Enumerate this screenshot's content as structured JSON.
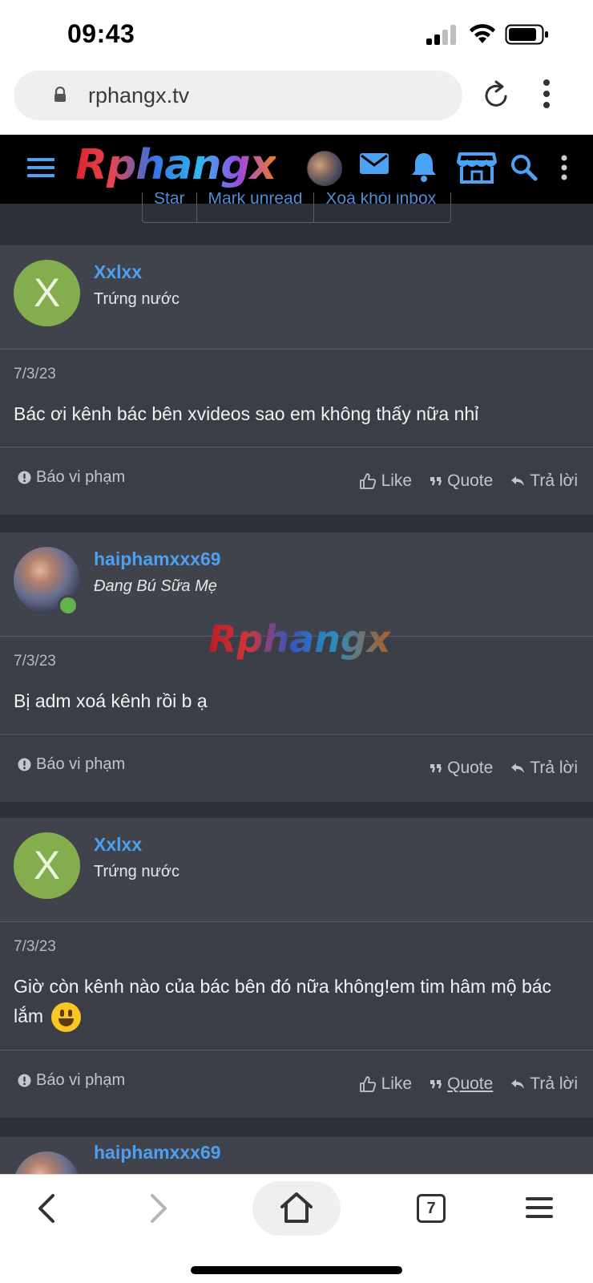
{
  "status_bar": {
    "time": "09:43"
  },
  "browser": {
    "url": "rphangx.tv",
    "tab_count": "7"
  },
  "site": {
    "logo_text": "Rphangx",
    "watermark": "Rphangx"
  },
  "toolbar_remnant": {
    "items": [
      "Star",
      "Mark unread",
      "Xoá khỏi inbox"
    ]
  },
  "colors": {
    "accent": "#4f9ff0",
    "card_bg": "#3b3e46",
    "header_bg": "#000000"
  },
  "messages": [
    {
      "username": "Xxlxx",
      "avatar_letter": "X",
      "user_title": "Trứng nước",
      "date": "7/3/23",
      "text": "Bác ơi kênh bác bên xvideos sao em không thấy nữa nhỉ",
      "report_label": "Báo vi phạm",
      "like_label": "Like",
      "quote_label": "Quote",
      "reply_label": "Trả lời"
    },
    {
      "username": "haiphamxxx69",
      "user_title": "Đang Bú Sữa Mẹ",
      "date": "7/3/23",
      "text": "Bị adm xoá kênh rồi b ạ",
      "report_label": "Báo vi phạm",
      "quote_label": "Quote",
      "reply_label": "Trả lời"
    },
    {
      "username": "Xxlxx",
      "avatar_letter": "X",
      "user_title": "Trứng nước",
      "date": "7/3/23",
      "text": "Giờ còn kênh nào của bác bên đó nữa không!em tim hâm mộ bác lắm",
      "report_label": "Báo vi phạm",
      "like_label": "Like",
      "quote_label": "Quote",
      "reply_label": "Trả lời"
    },
    {
      "username": "haiphamxxx69"
    }
  ],
  "icons": [
    "lock-icon",
    "reload-icon",
    "kebab-icon",
    "menu-icon",
    "mail-icon",
    "bell-icon",
    "store-icon",
    "search-icon",
    "back-icon",
    "forward-icon",
    "home-icon",
    "tabs-icon",
    "browser-menu-icon"
  ]
}
